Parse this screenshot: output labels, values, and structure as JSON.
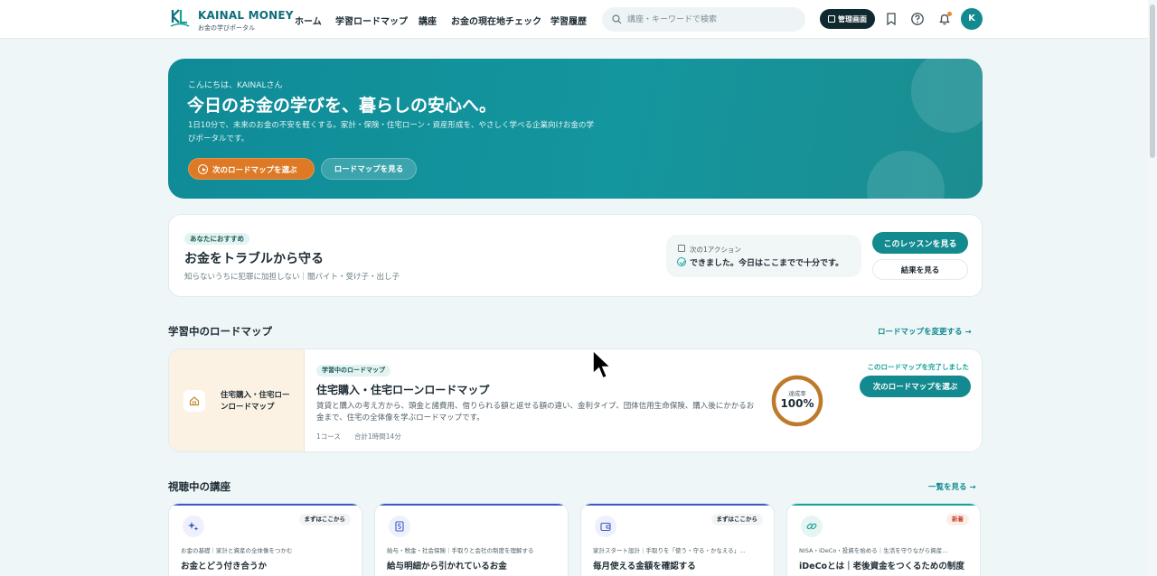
{
  "header": {
    "brand": "KAINAL MONEY",
    "brand_sub": "お金の学びポータル",
    "nav": [
      "ホーム",
      "学習ロードマップ",
      "講座",
      "お金の現在地チェック",
      "学習履歴"
    ],
    "search_placeholder": "講座・キーワードで検索",
    "admin_label": "管理画面",
    "avatar_initial": "K",
    "colors": {
      "brand": "#0e6f7a",
      "accent": "#138a8f",
      "notification_dot": "#e58a2b"
    }
  },
  "hero": {
    "greeting": "こんにちは、KAINALさん",
    "title": "今日のお金の学びを、暮らしの安心へ。",
    "description": "1日10分で、未来のお金の不安を軽くする。家計・保険・住宅ローン・資産形成を、やさしく学べる企業向けお金の学びポータルです。",
    "primary_button": "次のロードマップを選ぶ",
    "secondary_button": "ロードマップを見る"
  },
  "recommendation": {
    "badge": "あなたにおすすめ",
    "title": "お金をトラブルから守る",
    "subtitle": "知らないうちに犯罪に加担しない｜闇バイト・受け子・出し子",
    "next_action_label": "次の1アクション",
    "next_action_text": "できました。今日はここまでで十分です。",
    "primary_button": "このレッスンを見る",
    "secondary_button": "結果を見る"
  },
  "roadmap_section": {
    "title": "学習中のロードマップ",
    "link": "ロードマップを変更する →",
    "card": {
      "side_title": "住宅購入・住宅ローンロードマップ",
      "badge": "学習中のロードマップ",
      "title": "住宅購入・住宅ローンロードマップ",
      "description": "賃貸と購入の考え方から、頭金と諸費用、借りられる額と返せる額の違い、金利タイプ、団体信用生命保険、購入後にかかるお金まで、住宅の全体像を学ぶロードマップです。",
      "courses": "1コース",
      "duration": "合計1時間14分",
      "progress_label": "達成率",
      "progress_value": "100%",
      "progress_fraction": 1.0,
      "completed_text": "このロードマップを完了しました",
      "button": "次のロードマップを選ぶ"
    }
  },
  "courses_section": {
    "title": "視聴中の講座",
    "link": "一覧を見る →",
    "items": [
      {
        "icon": "sparkle-icon",
        "tag": "まずはここから",
        "category": "お金の基礎｜家計と資産の全体像をつかむ",
        "title": "お金とどう付き合うか",
        "color": "#3b5bc4"
      },
      {
        "icon": "document-icon",
        "tag": "",
        "category": "給与・税金・社会保険｜手取りと会社の制度を理解する",
        "title": "給与明細から引かれているお金",
        "color": "#3b5bc4"
      },
      {
        "icon": "wallet-icon",
        "tag": "まずはここから",
        "category": "家計スタート設計｜手取りを「使う・守る・かなえる」…",
        "title": "毎月使える金額を確認する",
        "color": "#3b5bc4"
      },
      {
        "icon": "link-icon",
        "tag": "新着",
        "category": "NISA・iDeCo・投資を始める｜生活を守りながら資産…",
        "title": "iDeCoとは｜老後資金をつくるための制度",
        "color": "#17a398"
      }
    ]
  }
}
